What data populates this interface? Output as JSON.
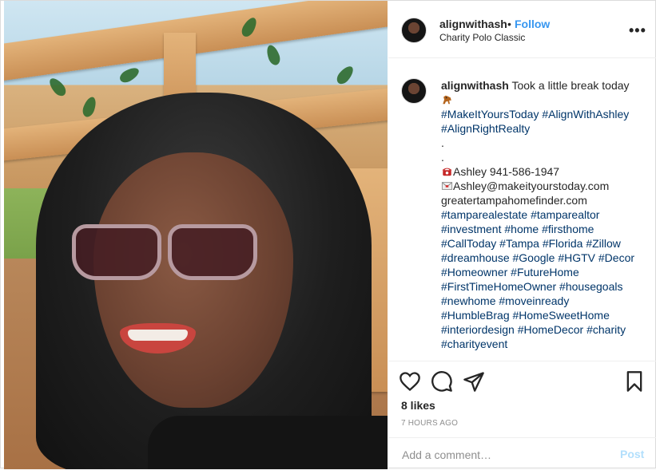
{
  "header": {
    "username": "alignwithash",
    "separator": "•",
    "follow_label": "Follow",
    "location": "Charity Polo Classic",
    "more_label": "•••"
  },
  "caption": {
    "username": "alignwithash",
    "text": "Took a little break today",
    "lines": [
      {
        "kind": "tag",
        "text": "#MakeItYoursToday #AlignWithAshley"
      },
      {
        "kind": "tag",
        "text": "#AlignRightRealty"
      },
      {
        "kind": "text",
        "text": "."
      },
      {
        "kind": "text",
        "text": "."
      },
      {
        "kind": "text",
        "text": "Ashley 941-586-1947"
      },
      {
        "kind": "text",
        "text": "Ashley@makeityourstoday.com"
      },
      {
        "kind": "text",
        "text": "greatertampahomefinder.com"
      },
      {
        "kind": "tag",
        "text": "#tamparealestate #tamparealtor"
      },
      {
        "kind": "tag",
        "text": "#investment #home #firsthome"
      },
      {
        "kind": "tag",
        "text": "#CallToday #Tampa #Florida #Zillow"
      },
      {
        "kind": "tag",
        "text": "#dreamhouse #Google #HGTV #Decor"
      },
      {
        "kind": "tag",
        "text": "#Homeowner #FutureHome"
      },
      {
        "kind": "tag",
        "text": "#FirstTimeHomeOwner #housegoals"
      },
      {
        "kind": "tag",
        "text": "#newhome #moveinready"
      },
      {
        "kind": "tag",
        "text": "#HumbleBrag #HomeSweetHome"
      },
      {
        "kind": "tag",
        "text": "#interiordesign #HomeDecor #charity"
      },
      {
        "kind": "tag",
        "text": "#charityevent"
      }
    ]
  },
  "engagement": {
    "likes": "8 likes",
    "timestamp": "7 hours ago"
  },
  "comment_box": {
    "placeholder": "Add a comment…",
    "post_label": "Post"
  },
  "icons": {
    "like": "heart-icon",
    "comment": "comment-bubble-icon",
    "share": "paper-plane-icon",
    "save": "bookmark-icon",
    "phone": "telephone-icon",
    "mail": "envelope-icon",
    "caption_emoji": "horse-icon"
  },
  "colors": {
    "link": "#003569",
    "follow": "#3897f0",
    "post_disabled": "#b2dffc",
    "muted": "#8e8e8e"
  }
}
